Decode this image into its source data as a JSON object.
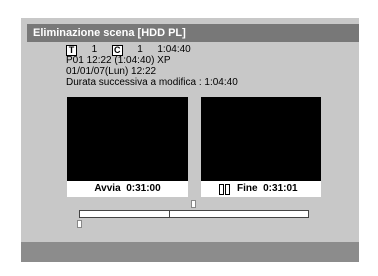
{
  "title": "Eliminazione scena [HDD PL]",
  "info": {
    "title_icon": "T",
    "title_number": "1",
    "chapter_icon": "C",
    "chapter_number": "1",
    "duration": "1:04:40",
    "program_line": "P01  12:22 (1:04:40) XP",
    "date_line": "01/01/07(Lun)  12:22",
    "after_edit_line": "Durata successiva a modifica : 1:04:40"
  },
  "start": {
    "label": "Avvia",
    "time": "0:31:00"
  },
  "end": {
    "label": "Fine",
    "time": "0:31:01",
    "icon": "pause-icon"
  }
}
